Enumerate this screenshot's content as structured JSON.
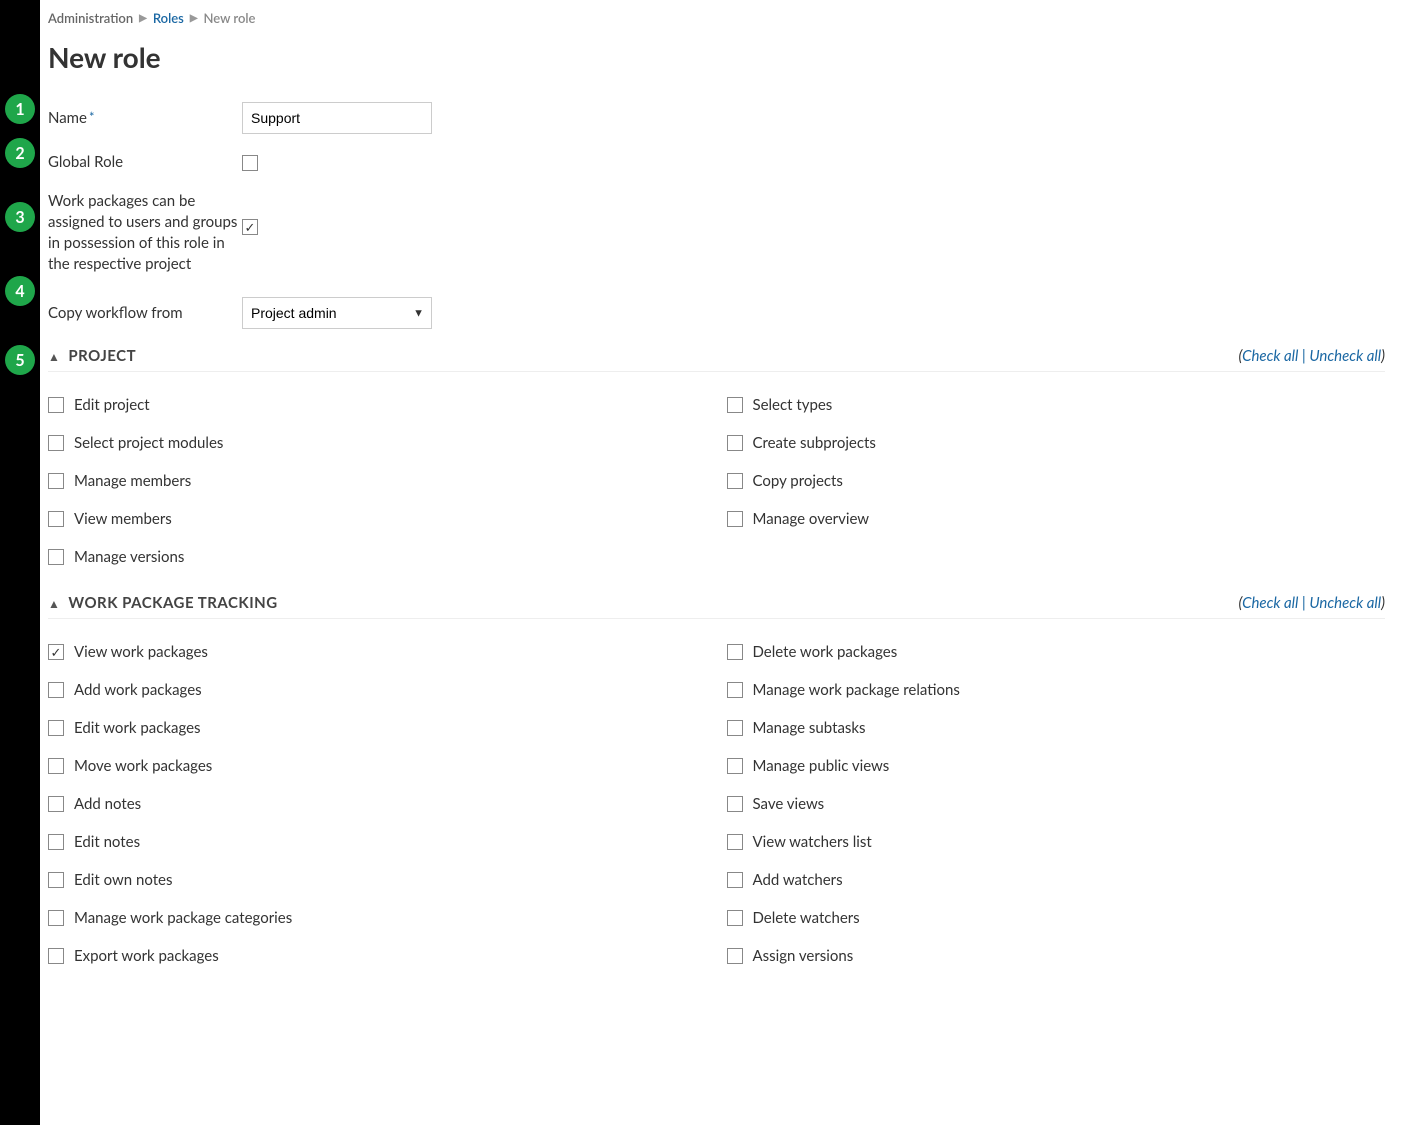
{
  "breadcrumb": {
    "admin": "Administration",
    "roles": "Roles",
    "current": "New role"
  },
  "title": "New role",
  "badges": [
    "1",
    "2",
    "3",
    "4",
    "5"
  ],
  "form": {
    "name_label": "Name",
    "name_value": "Support",
    "global_label": "Global Role",
    "global_checked": false,
    "assignable_label": "Work packages can be assigned to users and groups in possession of this role in the respective project",
    "assignable_checked": true,
    "copy_label": "Copy workflow from",
    "copy_value": "Project admin"
  },
  "check_all": "Check all",
  "uncheck_all": "Uncheck all",
  "sections": [
    {
      "title": "PROJECT",
      "left": [
        {
          "label": "Edit project",
          "checked": false
        },
        {
          "label": "Select project modules",
          "checked": false
        },
        {
          "label": "Manage members",
          "checked": false
        },
        {
          "label": "View members",
          "checked": false
        },
        {
          "label": "Manage versions",
          "checked": false
        }
      ],
      "right": [
        {
          "label": "Select types",
          "checked": false
        },
        {
          "label": "Create subprojects",
          "checked": false
        },
        {
          "label": "Copy projects",
          "checked": false
        },
        {
          "label": "Manage overview",
          "checked": false
        }
      ]
    },
    {
      "title": "WORK PACKAGE TRACKING",
      "left": [
        {
          "label": "View work packages",
          "checked": true
        },
        {
          "label": "Add work packages",
          "checked": false
        },
        {
          "label": "Edit work packages",
          "checked": false
        },
        {
          "label": "Move work packages",
          "checked": false
        },
        {
          "label": "Add notes",
          "checked": false
        },
        {
          "label": "Edit notes",
          "checked": false
        },
        {
          "label": "Edit own notes",
          "checked": false
        },
        {
          "label": "Manage work package categories",
          "checked": false
        },
        {
          "label": "Export work packages",
          "checked": false
        }
      ],
      "right": [
        {
          "label": "Delete work packages",
          "checked": false
        },
        {
          "label": "Manage work package relations",
          "checked": false
        },
        {
          "label": "Manage subtasks",
          "checked": false
        },
        {
          "label": "Manage public views",
          "checked": false
        },
        {
          "label": "Save views",
          "checked": false
        },
        {
          "label": "View watchers list",
          "checked": false
        },
        {
          "label": "Add watchers",
          "checked": false
        },
        {
          "label": "Delete watchers",
          "checked": false
        },
        {
          "label": "Assign versions",
          "checked": false
        }
      ]
    }
  ]
}
